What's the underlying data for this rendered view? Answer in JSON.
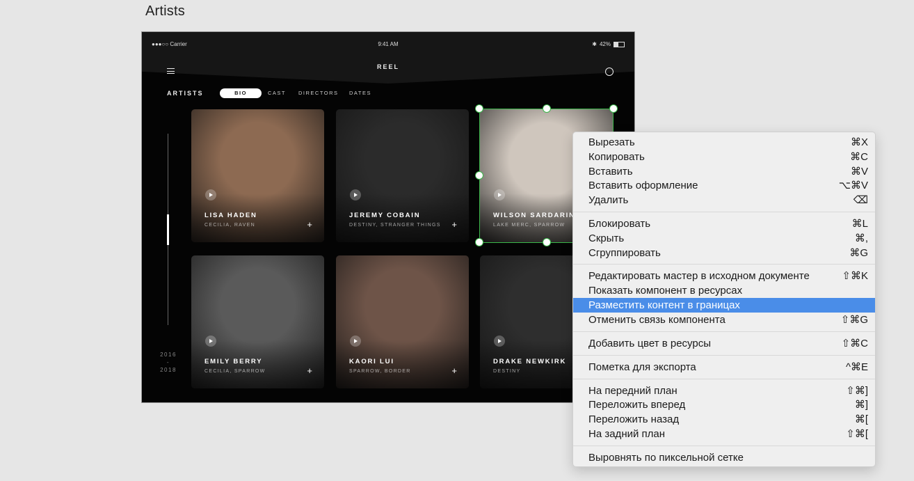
{
  "artboard_title": "Artists",
  "app": {
    "status": {
      "carrier": "●●●○○ Carrier",
      "time": "9:41 AM",
      "battery": "42%"
    },
    "title": "REEL",
    "section": "ARTISTS",
    "tabs": [
      {
        "label": "BIO",
        "active": true
      },
      {
        "label": "CAST"
      },
      {
        "label": "DIRECTORS"
      },
      {
        "label": "DATES"
      }
    ],
    "years": {
      "start": "2016",
      "dash": "-",
      "end": "2018"
    },
    "cards": [
      {
        "name": "LISA HADEN",
        "roles": "CECILIA, RAVEN",
        "bg": "#8d6a52"
      },
      {
        "name": "JEREMY COBAIN",
        "roles": "DESTINY, STRANGER THINGS",
        "bg": "#2b2b2b"
      },
      {
        "name": "WILSON SARDARINI",
        "roles": "LAKE MERC, SPARROW",
        "bg": "#cfc6bd"
      },
      {
        "name": "EMILY BERRY",
        "roles": "CECILIA, SPARROW",
        "bg": "#5a5a5a"
      },
      {
        "name": "KAORI LUI",
        "roles": "SPARROW, BORDER",
        "bg": "#6e5448"
      },
      {
        "name": "DRAKE NEWKIRK",
        "roles": "DESTINY",
        "bg": "#2e2e2e"
      }
    ]
  },
  "context_menu": {
    "items": [
      {
        "label": "Вырезать",
        "shortcut": "⌘X"
      },
      {
        "label": "Копировать",
        "shortcut": "⌘C"
      },
      {
        "label": "Вставить",
        "shortcut": "⌘V"
      },
      {
        "label": "Вставить оформление",
        "shortcut": "⌥⌘V"
      },
      {
        "label": "Удалить",
        "shortcut": "⌫"
      },
      {
        "label": "Блокировать",
        "shortcut": "⌘L"
      },
      {
        "label": "Скрыть",
        "shortcut": "⌘,"
      },
      {
        "label": "Сгруппировать",
        "shortcut": "⌘G"
      },
      {
        "label": "Редактировать мастер в исходном документе",
        "shortcut": "⇧⌘K"
      },
      {
        "label": "Показать компонент в ресурсах",
        "shortcut": ""
      },
      {
        "label": "Разместить контент в границах",
        "shortcut": "",
        "highlighted": true
      },
      {
        "label": "Отменить связь компонента",
        "shortcut": "⇧⌘G"
      },
      {
        "label": "Добавить цвет в ресурсы",
        "shortcut": "⇧⌘C"
      },
      {
        "label": "Пометка для экспорта",
        "shortcut": "^⌘E"
      },
      {
        "label": "На передний план",
        "shortcut": "⇧⌘]"
      },
      {
        "label": "Переложить вперед",
        "shortcut": "⌘]"
      },
      {
        "label": "Переложить назад",
        "shortcut": "⌘["
      },
      {
        "label": "На задний план",
        "shortcut": "⇧⌘["
      },
      {
        "label": "Выровнять по пиксельной сетке",
        "shortcut": ""
      }
    ]
  },
  "colors": {
    "selection": "#3bb84a",
    "menu_highlight": "#4a8de8"
  }
}
